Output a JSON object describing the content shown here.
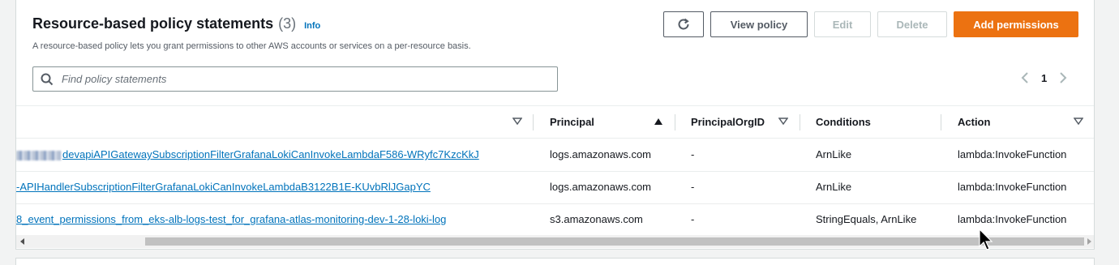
{
  "header": {
    "title": "Resource-based policy statements",
    "count": "(3)",
    "info": "Info",
    "description": "A resource-based policy lets you grant permissions to other AWS accounts or services on a per-resource basis."
  },
  "toolbar": {
    "refresh_icon": "refresh-icon",
    "view_policy": "View policy",
    "edit": "Edit",
    "delete": "Delete",
    "add_permissions": "Add permissions",
    "accent_color": "#ec7211"
  },
  "search": {
    "placeholder": "Find policy statements",
    "value": ""
  },
  "pagination": {
    "current_page": "1"
  },
  "table": {
    "columns": [
      "Principal",
      "PrincipalOrgID",
      "Conditions",
      "Action"
    ],
    "sorted_column": "Principal",
    "rows": [
      {
        "statement_id": "devapiAPIGatewaySubscriptionFilterGrafanaLokiCanInvokeLambdaF586-WRyfc7KzcKkJ",
        "principal": "logs.amazonaws.com",
        "principal_org_id": "-",
        "conditions": "ArnLike",
        "action": "lambda:InvokeFunction"
      },
      {
        "statement_id": "-APIHandlerSubscriptionFilterGrafanaLokiCanInvokeLambdaB3122B1E-KUvbRlJGapYC",
        "principal": "logs.amazonaws.com",
        "principal_org_id": "-",
        "conditions": "ArnLike",
        "action": "lambda:InvokeFunction"
      },
      {
        "statement_id": "8_event_permissions_from_eks-alb-logs-test_for_grafana-atlas-monitoring-dev-1-28-loki-log",
        "principal": "s3.amazonaws.com",
        "principal_org_id": "-",
        "conditions": "StringEquals, ArnLike",
        "action": "lambda:InvokeFunction"
      }
    ]
  }
}
